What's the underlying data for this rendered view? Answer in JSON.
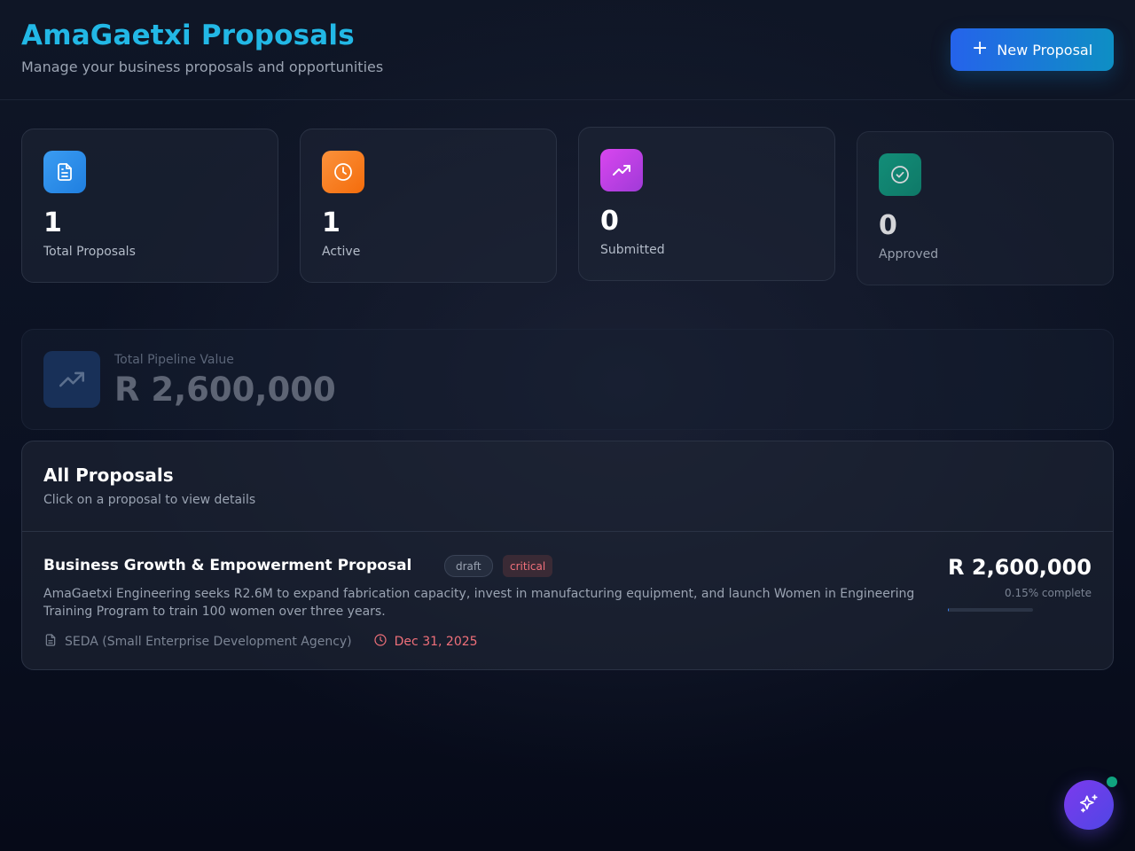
{
  "header": {
    "title": "AmaGaetxi Proposals",
    "subtitle": "Manage your business proposals and opportunities",
    "new_button_label": "New Proposal"
  },
  "stats": [
    {
      "value": "1",
      "label": "Total Proposals",
      "icon": "document-icon",
      "color": "#2b8ff0"
    },
    {
      "value": "1",
      "label": "Active",
      "icon": "clock-icon",
      "color": "#f97316"
    },
    {
      "value": "0",
      "label": "Submitted",
      "icon": "trending-up-icon",
      "color": "#c340d6"
    },
    {
      "value": "0",
      "label": "Approved",
      "icon": "check-circle-icon",
      "color": "#0e9f7e"
    }
  ],
  "pipeline": {
    "label": "Total Pipeline Value",
    "value": "R 2,600,000",
    "icon": "trending-up-icon"
  },
  "proposals": {
    "title": "All Proposals",
    "subtitle": "Click on a proposal to view details",
    "items": [
      {
        "title": "Business Growth & Empowerment Proposal",
        "status": "draft",
        "priority": "critical",
        "description": "AmaGaetxi Engineering seeks R2.6M to expand fabrication capacity, invest in manufacturing equipment, and launch Women in Engineering Training Program to train 100 women over three years.",
        "organization": "SEDA (Small Enterprise Development Agency)",
        "due_date": "Dec 31, 2025",
        "amount": "R 2,600,000",
        "progress_text": "0.15% complete",
        "progress": 0.0015
      }
    ]
  },
  "colors": {
    "accent": "#22b8e6",
    "critical": "#f0707a",
    "fab": "#7c3aed",
    "online": "#10a37f"
  }
}
